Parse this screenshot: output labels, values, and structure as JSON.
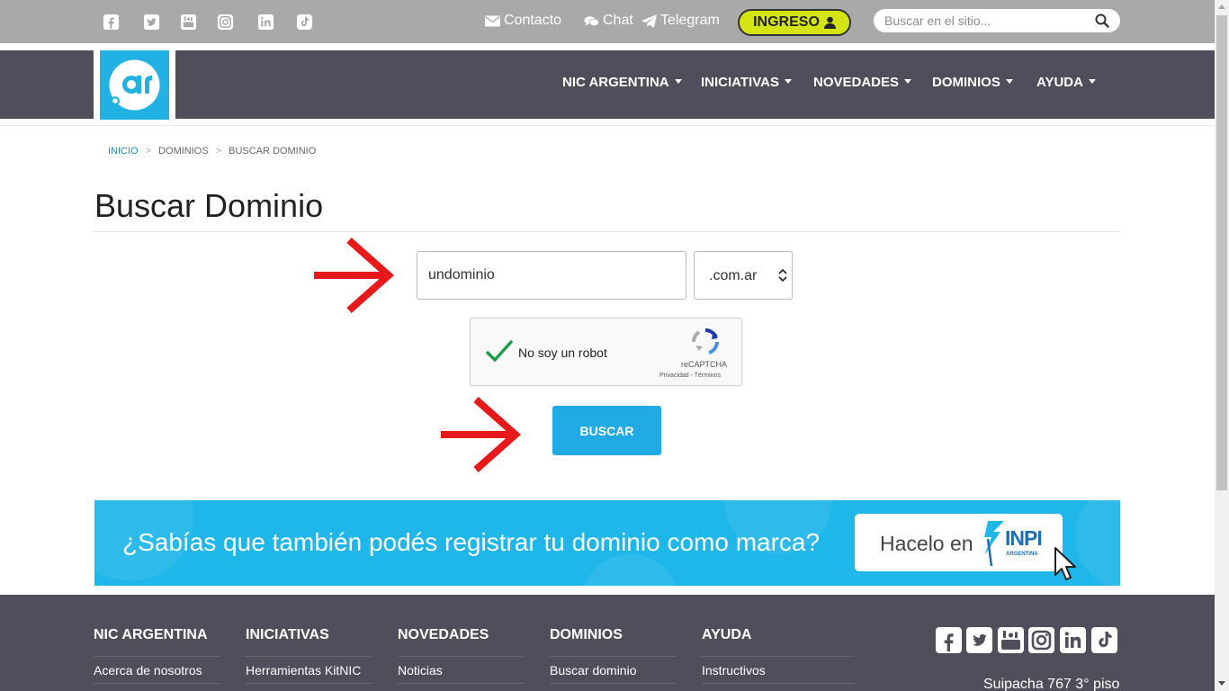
{
  "topbar": {
    "social": [
      "facebook-icon",
      "twitter-icon",
      "youtube-icon",
      "instagram-icon",
      "linkedin-icon",
      "tiktok-icon"
    ],
    "contacto": "Contacto",
    "chat": "Chat",
    "telegram": "Telegram",
    "ingreso": "INGRESO",
    "search_placeholder": "Buscar en el sitio..."
  },
  "nav": {
    "items": [
      "NIC ARGENTINA",
      "INICIATIVAS",
      "NOVEDADES",
      "DOMINIOS",
      "AYUDA"
    ]
  },
  "breadcrumb": {
    "items": [
      "INICIO",
      "DOMINIOS",
      "BUSCAR DOMINIO"
    ],
    "separator": ">"
  },
  "page": {
    "title": "Buscar Dominio"
  },
  "form": {
    "domain_value": "undominio",
    "tld_selected": ".com.ar",
    "captcha_label": "No soy un robot",
    "captcha_brand": "reCAPTCHA",
    "captcha_links": "Privacidad - Términos",
    "captcha_checked": true,
    "search_button": "BUSCAR"
  },
  "banner": {
    "text": "¿Sabías que también podés registrar tu dominio como marca?",
    "cta": "Hacelo en",
    "inpi": "INPI",
    "inpi_sub": "ARGENTINA"
  },
  "footer": {
    "columns": [
      {
        "heading": "NIC ARGENTINA",
        "link": "Acerca de nosotros"
      },
      {
        "heading": "INICIATIVAS",
        "link": "Herramientas KitNIC"
      },
      {
        "heading": "NOVEDADES",
        "link": "Noticias"
      },
      {
        "heading": "DOMINIOS",
        "link": "Buscar dominio"
      },
      {
        "heading": "AYUDA",
        "link": "Instructivos"
      }
    ],
    "address": "Suipacha 767 3° piso"
  },
  "colors": {
    "topbar": "#a9a9a9",
    "nav": "#4e4f5a",
    "accent": "#21aae3",
    "ingreso": "#d4e312",
    "annotation_arrow": "#e8191a"
  }
}
